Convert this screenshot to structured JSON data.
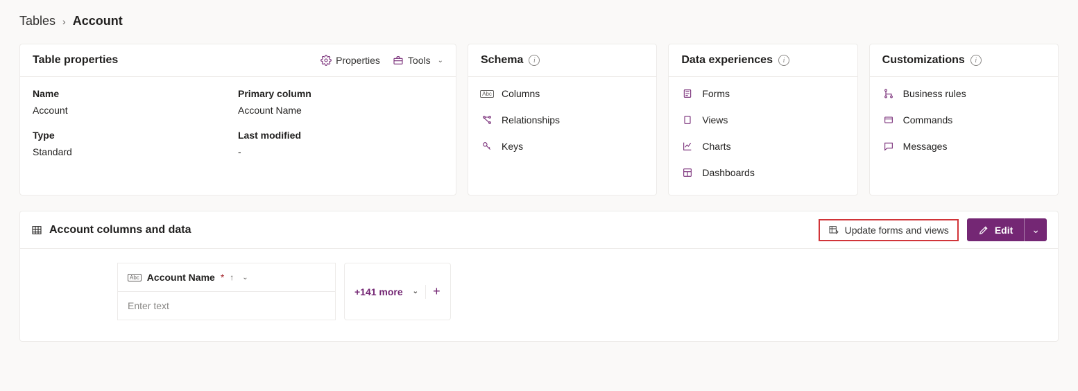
{
  "breadcrumb": {
    "root": "Tables",
    "current": "Account"
  },
  "tableProps": {
    "title": "Table properties",
    "actions": {
      "properties": "Properties",
      "tools": "Tools"
    },
    "labels": {
      "name": "Name",
      "primary": "Primary column",
      "type": "Type",
      "modified": "Last modified"
    },
    "values": {
      "name": "Account",
      "primary": "Account Name",
      "type": "Standard",
      "modified": "-"
    }
  },
  "schema": {
    "title": "Schema",
    "items": {
      "columns": "Columns",
      "relationships": "Relationships",
      "keys": "Keys"
    }
  },
  "dataExp": {
    "title": "Data experiences",
    "items": {
      "forms": "Forms",
      "views": "Views",
      "charts": "Charts",
      "dashboards": "Dashboards"
    }
  },
  "custom": {
    "title": "Customizations",
    "items": {
      "rules": "Business rules",
      "commands": "Commands",
      "messages": "Messages"
    }
  },
  "dataPanel": {
    "title": "Account columns and data",
    "update": "Update forms and views",
    "edit": "Edit",
    "column": "Account Name",
    "more": "+141 more",
    "placeholder": "Enter text"
  }
}
